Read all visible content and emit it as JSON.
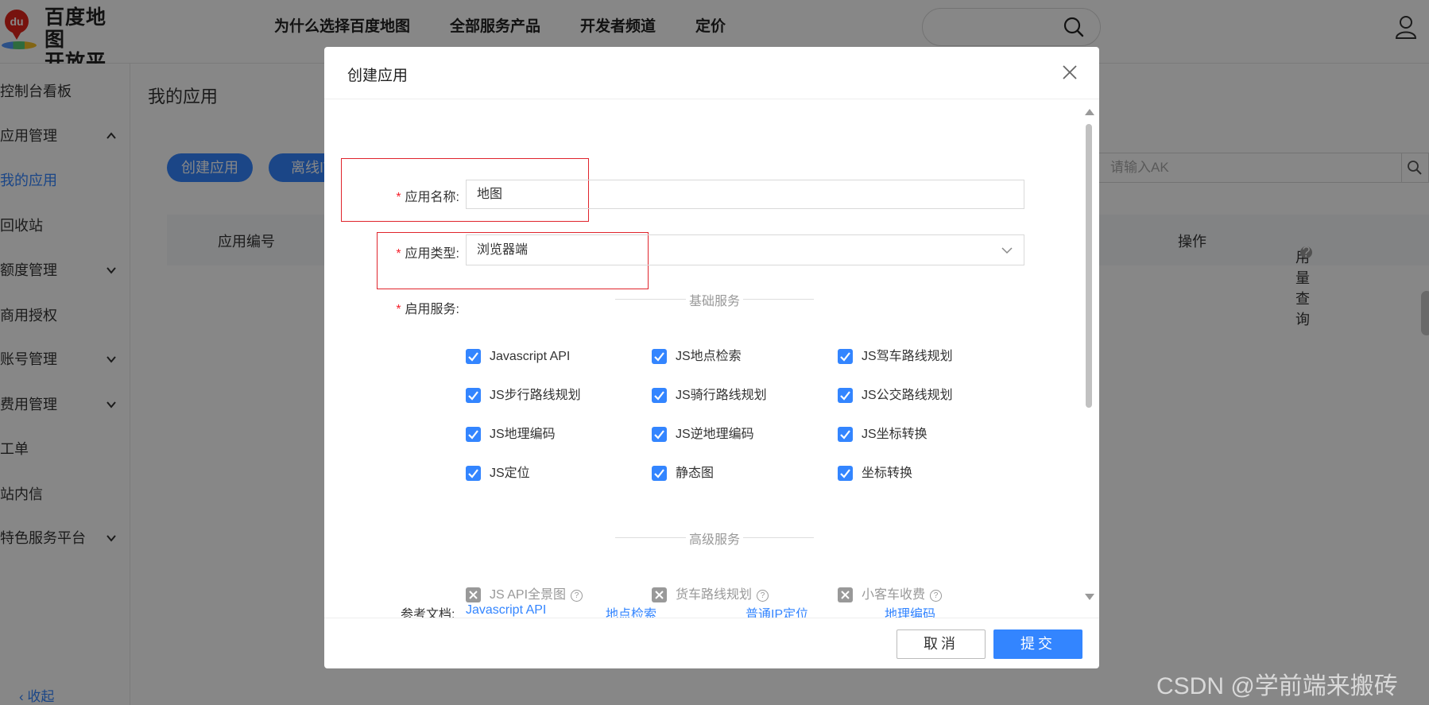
{
  "header": {
    "logo_text_line1": "百度地图",
    "logo_text_line2": "开放平台",
    "logo_badge": "du",
    "nav": [
      "为什么选择百度地图",
      "全部服务产品",
      "开发者频道",
      "定价"
    ]
  },
  "sidebar": {
    "items": [
      {
        "label": "控制台看板",
        "has_chevron": false
      },
      {
        "label": "应用管理",
        "has_chevron": true,
        "expanded": true
      },
      {
        "label": "我的应用",
        "active": true
      },
      {
        "label": "回收站"
      },
      {
        "label": "额度管理",
        "has_chevron": true
      },
      {
        "label": "商用授权"
      },
      {
        "label": "账号管理",
        "has_chevron": true
      },
      {
        "label": "费用管理",
        "has_chevron": true
      },
      {
        "label": "工单"
      },
      {
        "label": "站内信"
      },
      {
        "label": "特色服务平台",
        "has_chevron": true
      }
    ],
    "collapse_label": "收起"
  },
  "main": {
    "title": "我的应用",
    "create_button": "创建应用",
    "offline_button": "离线IT",
    "ak_placeholder": "请输入AK",
    "table_headers": [
      "应用编号",
      "操作",
      "用量查询"
    ]
  },
  "modal": {
    "title": "创建应用",
    "fields": {
      "app_name_label": "应用名称:",
      "app_name_value": "地图",
      "app_type_label": "应用类型:",
      "app_type_value": "浏览器端",
      "services_label": "启用服务:"
    },
    "basic_section": "基础服务",
    "basic_services": [
      "Javascript API",
      "JS地点检索",
      "JS驾车路线规划",
      "JS步行路线规划",
      "JS骑行路线规划",
      "JS公交路线规划",
      "JS地理编码",
      "JS逆地理编码",
      "JS坐标转换",
      "JS定位",
      "静态图",
      "坐标转换"
    ],
    "advanced_section": "高级服务",
    "advanced_services": [
      "JS API全景图",
      "货车路线规划",
      "小客车收费"
    ],
    "ref_label": "参考文档:",
    "ref_links": [
      "Javascript API",
      "地点检索",
      "普通IP定位",
      "地理编码"
    ],
    "cancel": "取消",
    "submit": "提交"
  },
  "watermark": "CSDN @学前端来搬砖",
  "colors": {
    "accent": "#3385ff",
    "required": "#f5222d",
    "highlight_box": "#e0242c"
  }
}
